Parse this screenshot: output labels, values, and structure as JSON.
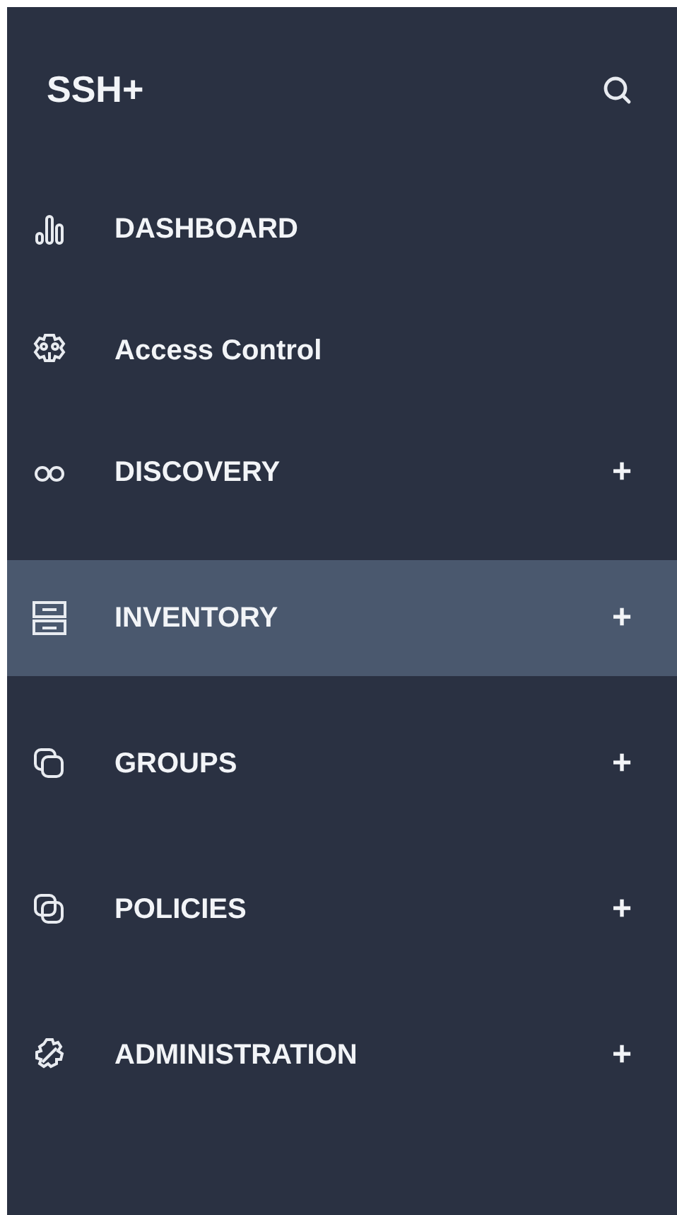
{
  "sidebar": {
    "title": "SSH+",
    "items": [
      {
        "label": "DASHBOARD",
        "selected": false
      },
      {
        "label": "Access Control",
        "selected": false
      },
      {
        "label": "DISCOVERY",
        "selected": false,
        "toggle": "+"
      },
      {
        "label": "INVENTORY",
        "selected": true,
        "toggle": "+"
      },
      {
        "label": "GROUPS",
        "selected": false,
        "toggle": "+"
      },
      {
        "label": "POLICIES",
        "selected": false,
        "toggle": "+"
      },
      {
        "label": "ADMINISTRATION",
        "selected": false,
        "toggle": "+"
      }
    ]
  }
}
